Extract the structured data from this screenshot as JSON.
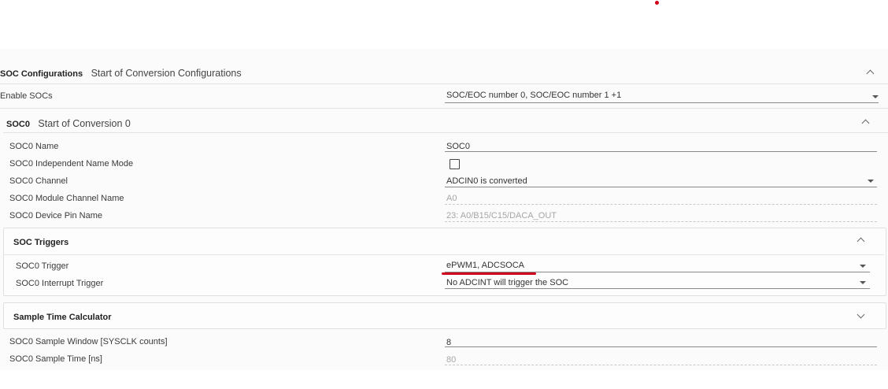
{
  "soc_configurations": {
    "title": "SOC Configurations",
    "subtitle": "Start of Conversion Configurations",
    "enable_socs_label": "Enable SOCs",
    "enable_socs_value": "SOC/EOC number 0, SOC/EOC number 1 +1"
  },
  "soc0": {
    "title": "SOC0",
    "subtitle": "Start of Conversion 0",
    "fields": {
      "name_label": "SOC0 Name",
      "name_value": "SOC0",
      "indep_label": "SOC0 Independent Name Mode",
      "channel_label": "SOC0 Channel",
      "channel_value": "ADCIN0 is converted",
      "module_channel_label": "SOC0 Module Channel Name",
      "module_channel_value": "A0",
      "device_pin_label": "SOC0 Device Pin Name",
      "device_pin_value": "23: A0/B15/C15/DACA_OUT"
    }
  },
  "soc_triggers": {
    "title": "SOC Triggers",
    "trigger_label": "SOC0 Trigger",
    "trigger_value": "ePWM1, ADCSOCA",
    "interrupt_label": "SOC0 Interrupt Trigger",
    "interrupt_value": "No ADCINT will trigger the SOC"
  },
  "sample_time": {
    "title": "Sample Time Calculator",
    "window_label": "SOC0 Sample Window [SYSCLK counts]",
    "window_value": "8",
    "time_label": "SOC0 Sample Time [ns]",
    "time_value": "80"
  },
  "icons": [
    "chevron-up-icon",
    "chevron-down-icon",
    "dropdown-caret-icon",
    "checkbox"
  ],
  "colors": {
    "annotation_red": "#d0021b"
  }
}
